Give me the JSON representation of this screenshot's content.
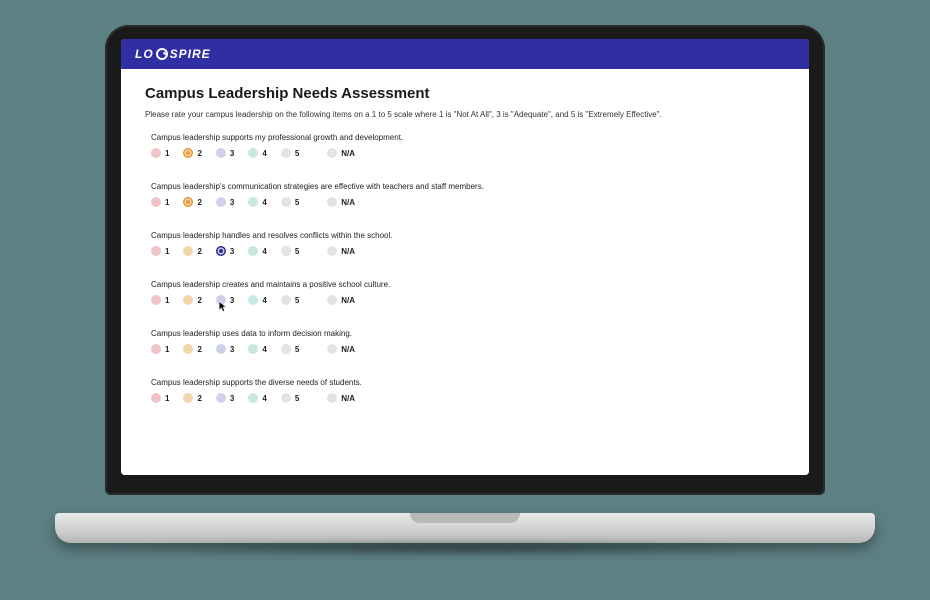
{
  "brand": {
    "name_left": "LO",
    "name_right": "SPIRE"
  },
  "page": {
    "title": "Campus Leadership Needs Assessment",
    "subtitle": "Please rate your campus leadership on the following items on a 1 to 5 scale where 1 is \"Not At All\", 3 is \"Adequate\", and 5 is \"Extremely Effective\"."
  },
  "scale": {
    "options": [
      {
        "value": "1",
        "color": "c1"
      },
      {
        "value": "2",
        "color": "c2"
      },
      {
        "value": "3",
        "color": "c3"
      },
      {
        "value": "4",
        "color": "c4"
      },
      {
        "value": "5",
        "color": "c5"
      }
    ],
    "na_label": "N/A"
  },
  "questions": [
    {
      "text": "Campus leadership supports my professional growth and development.",
      "selected": "2"
    },
    {
      "text": "Campus leadership's communication strategies are effective with teachers and staff members.",
      "selected": "2"
    },
    {
      "text": "Campus leadership handles and resolves conflicts within the school.",
      "selected": "3"
    },
    {
      "text": "Campus leadership creates and maintains a positive school culture.",
      "selected": null,
      "cursor_at": "3"
    },
    {
      "text": "Campus leadership uses data to inform decision making.",
      "selected": null
    },
    {
      "text": "Campus leadership supports the diverse needs of students.",
      "selected": null
    }
  ]
}
